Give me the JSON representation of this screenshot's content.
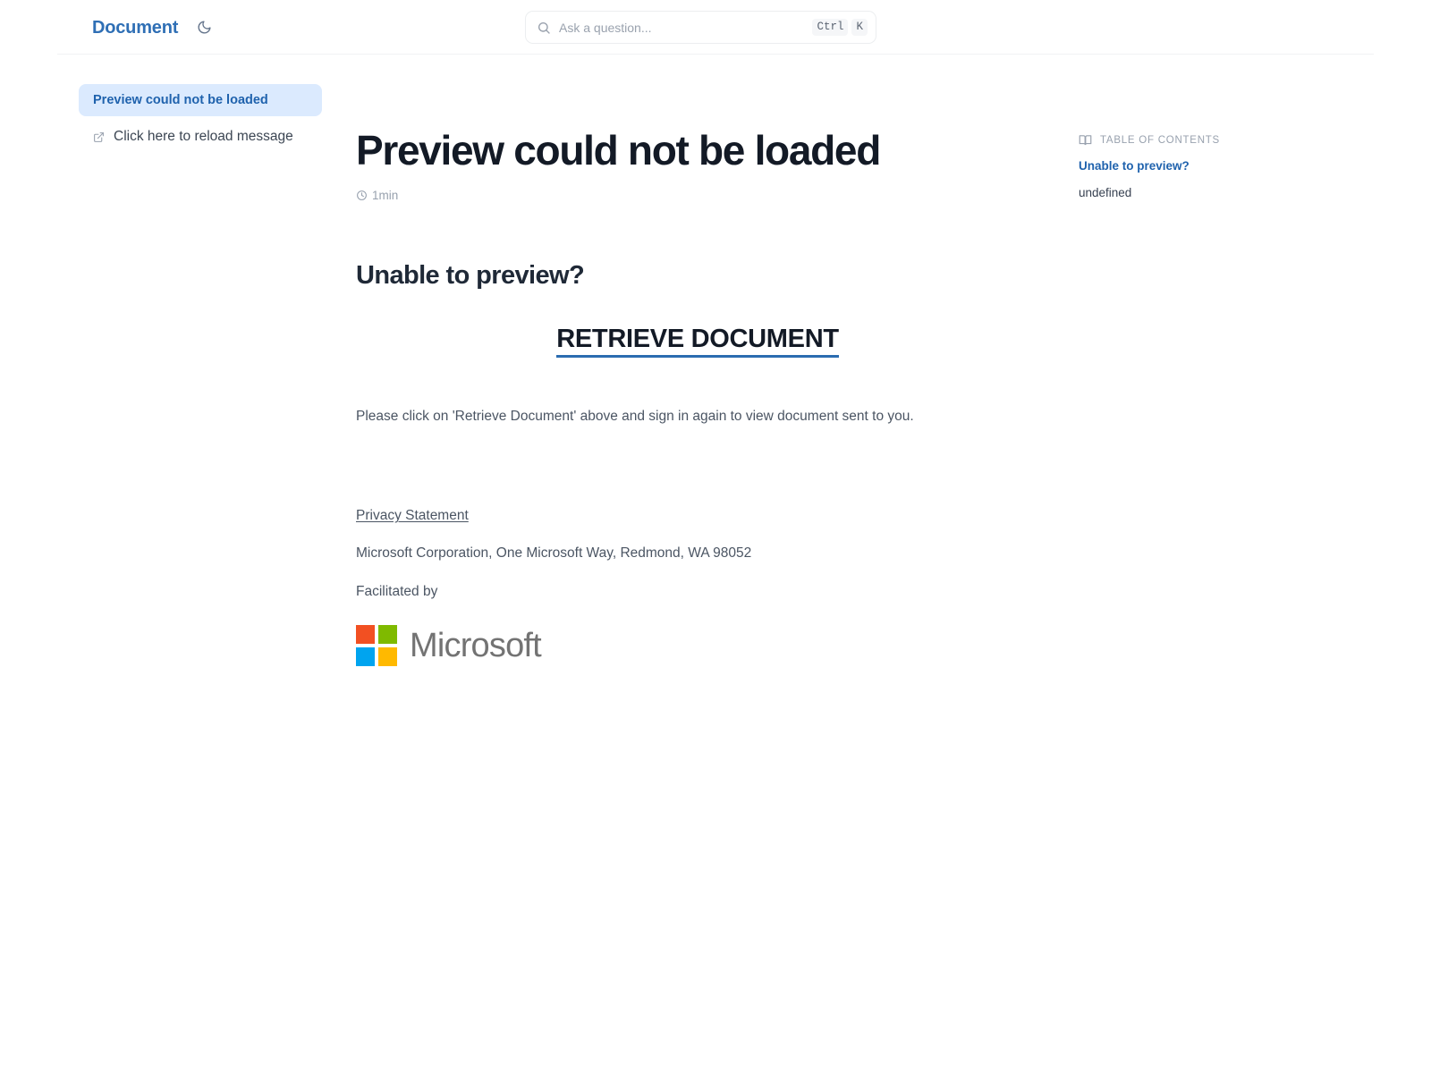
{
  "header": {
    "brand": "Document",
    "theme_toggle_icon": "moon-icon",
    "search": {
      "placeholder": "Ask a question...",
      "value": "",
      "icon": "search-icon",
      "shortcut_modifier": "Ctrl",
      "shortcut_key": "K"
    }
  },
  "sidebar": {
    "items": [
      {
        "label": "Preview could not be loaded",
        "active": true,
        "icon": null
      },
      {
        "label": "Click here to reload message",
        "active": false,
        "icon": "external-link-icon"
      }
    ]
  },
  "document": {
    "title": "Preview could not be loaded",
    "reading_time": "1min",
    "reading_time_icon": "clock-icon",
    "section_heading": "Unable to preview?",
    "retrieve_link_label": "RETRIEVE DOCUMENT",
    "instruction": "Please click on 'Retrieve Document' above and sign in again to view document sent to you.",
    "footer": {
      "privacy_link": "Privacy Statement",
      "address": "Microsoft Corporation, One Microsoft Way, Redmond, WA 98052",
      "facilitated_label": "Facilitated by",
      "logo_wordmark": "Microsoft"
    }
  },
  "toc": {
    "heading": "TABLE OF CONTENTS",
    "heading_icon": "book-icon",
    "items": [
      {
        "label": "Unable to preview?",
        "active": true
      },
      {
        "label": "undefined",
        "active": false
      }
    ]
  },
  "colors": {
    "brand_blue": "#2f6fb5",
    "active_link_blue": "#1f62ad",
    "active_sidebar_bg": "#dbeafe",
    "retrieve_underline": "#2b6cb0",
    "ms_red": "#f25022",
    "ms_green": "#7fba00",
    "ms_blue": "#00a4ef",
    "ms_yellow": "#ffb900",
    "ms_wordmark_gray": "#737373"
  }
}
